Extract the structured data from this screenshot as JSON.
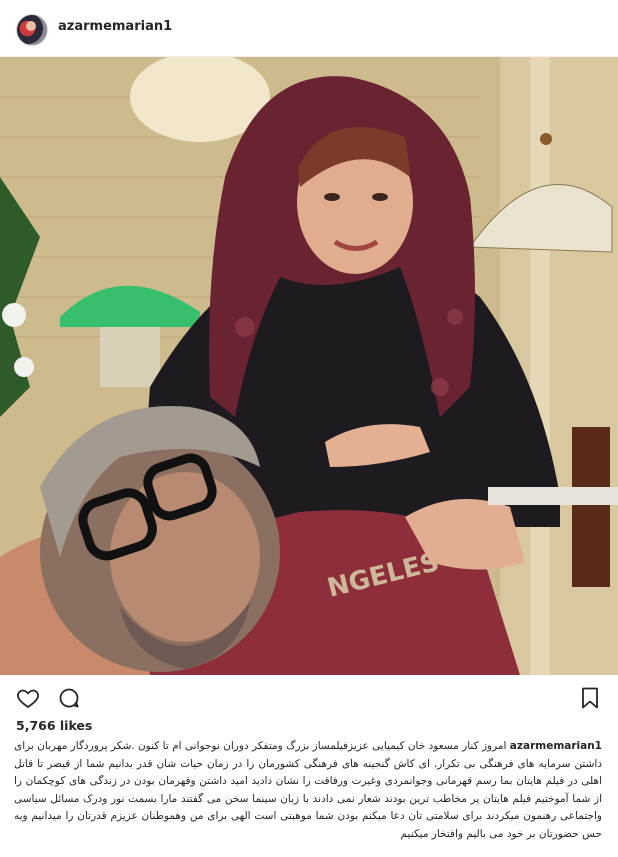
{
  "post": {
    "username": "azarmemarian1",
    "likes_text": "5,766 likes",
    "caption_user": "azarmemarian1",
    "caption_text": "امروز کنار مسعود خان کیمیایی عزیزفیلمساز بزرگ ومتفکر دوران نوجوانی ام تا کنون .شکر پروردگار مهربان برای داشتن سرمایه های فرهنگی بی تکرار. ای کاش گنجینه های فرهنگی کشورمان را در زمان حیات شان قدر بدانیم شما از قیصر تا قاتل اهلی در فیلم هایتان بما رسم قهرمانی وجوانمردی وغیرت ورفاقت را نشان دادید امید داشتن وقهرمان بودن در زندگی های کوچکمان را از شما آموختیم فیلم هایتان پر مخاطب ترین بودند شعار نمی دادند با زبان سینما سخن می گفتند مارا بسمت نور ودرک مسائل سیاسی واجتماعی رهنمون میکردند برای سلامتی تان دعا میکنم بودن شما موهبتی است الهی برای من وهموطنان عزیزم قدرتان را میدانیم وبه حس حضورتان بر خود می بالیم وافتخار میکنیم"
  },
  "icons": {
    "avatar": "profile-avatar",
    "like": "heart-outline-icon",
    "comment": "comment-bubble-icon",
    "save": "bookmark-outline-icon"
  },
  "colors": {
    "text": "#262626",
    "border": "#efefef",
    "background": "#ffffff"
  }
}
